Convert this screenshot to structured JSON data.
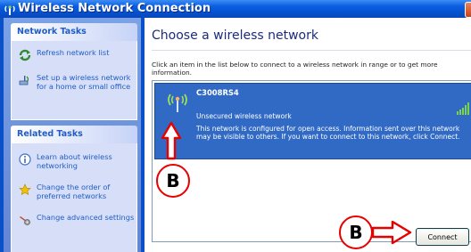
{
  "window": {
    "title": "Wireless Network Connection"
  },
  "network_tasks": {
    "heading": "Network Tasks",
    "items": [
      {
        "label": "Refresh network list",
        "icon": "refresh-icon"
      },
      {
        "label": "Set up a wireless network for a home or small office",
        "icon": "setup-network-icon"
      }
    ]
  },
  "related_tasks": {
    "heading": "Related Tasks",
    "items": [
      {
        "label": "Learn about wireless networking",
        "icon": "info-icon"
      },
      {
        "label": "Change the order of preferred networks",
        "icon": "star-icon"
      },
      {
        "label": "Change advanced settings",
        "icon": "settings-icon"
      }
    ]
  },
  "main": {
    "heading": "Choose a wireless network",
    "instructions": "Click an item in the list below to connect to a wireless network in range or to get more information.",
    "networks": [
      {
        "ssid": "C3008RS4",
        "security": "Unsecured wireless network",
        "description": "This network is configured for open access. Information sent over this network may be visible to others. If you want to connect to this network, click Connect.",
        "signal_bars": 5
      }
    ],
    "connect_label": "Connect"
  },
  "annotations": {
    "marker_1": "B",
    "marker_2": "B"
  },
  "colors": {
    "selection": "#316ac5",
    "annotation_red": "#e60000",
    "title_blue": "#0550d0"
  }
}
